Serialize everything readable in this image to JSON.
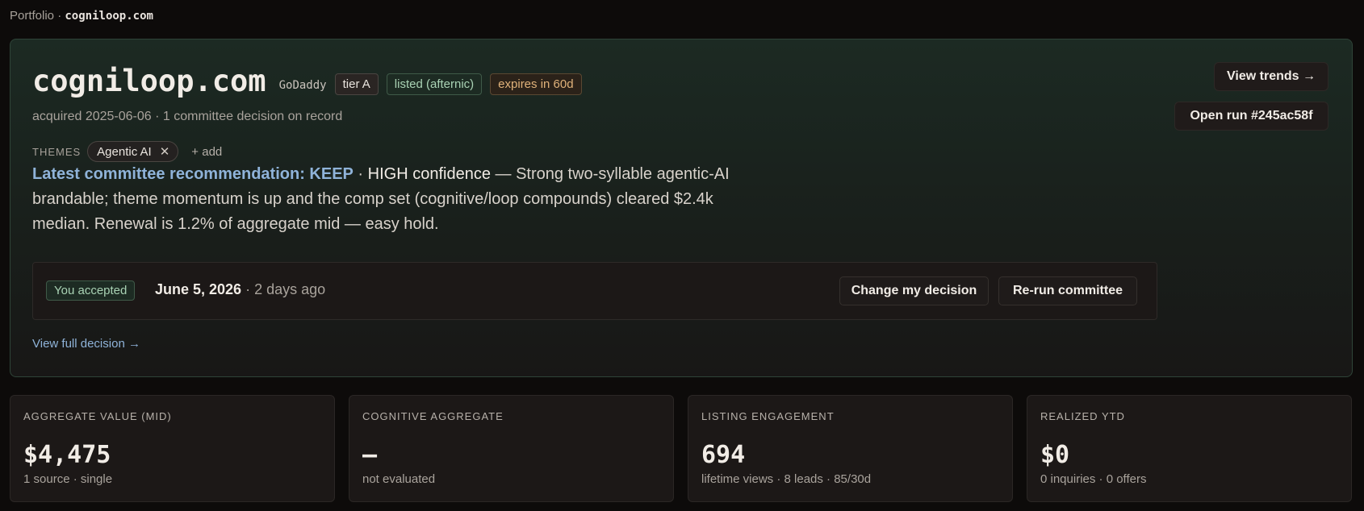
{
  "breadcrumb": {
    "root": "Portfolio",
    "separator": "·",
    "current": "cogniloop.com"
  },
  "header": {
    "domain": "cogniloop.com",
    "registrar": "GoDaddy",
    "tier_badge": "tier A",
    "listing_badge": "listed (afternic)",
    "expiry_badge": "expires in 60d",
    "meta": "acquired 2025-06-06 · 1 committee decision on record"
  },
  "themes": {
    "label": "THEMES",
    "items": [
      {
        "label": "Agentic AI",
        "remove_icon": "✕"
      }
    ],
    "add_label": "+ add"
  },
  "recommendation": {
    "heading": "Latest committee recommendation: KEEP",
    "separator": " · ",
    "confidence": "HIGH confidence",
    "rationale": " — Strong two-syllable agentic-AI brandable; theme momentum is up and the comp set (cognitive/loop compounds) cleared $2.4k median. Renewal is 1.2% of aggregate mid — easy hold."
  },
  "decision": {
    "status_badge": "You accepted",
    "date": "June 5, 2026",
    "relative": " · 2 days ago",
    "change_label": "Change my decision",
    "rerun_label": "Re-run committee"
  },
  "links": {
    "full_decision": "View full decision →"
  },
  "actions": {
    "trends_label": "View trends →",
    "open_run_label": "Open run #245ac58f"
  },
  "stats": [
    {
      "label": "AGGREGATE VALUE (MID)",
      "value": "$4,475",
      "sub": "1 source · single"
    },
    {
      "label": "COGNITIVE AGGREGATE",
      "value": "—",
      "sub": "not evaluated"
    },
    {
      "label": "LISTING ENGAGEMENT",
      "value": "694",
      "sub": "lifetime views · 8 leads · 85/30d"
    },
    {
      "label": "REALIZED YTD",
      "value": "$0",
      "sub": "0 inquiries · 0 offers"
    }
  ],
  "colors": {
    "accent_blue": "#8fb3d9",
    "success_green": "#a9d2b4",
    "warning_amber": "#e0b27a",
    "background": "#0d0b0a"
  }
}
